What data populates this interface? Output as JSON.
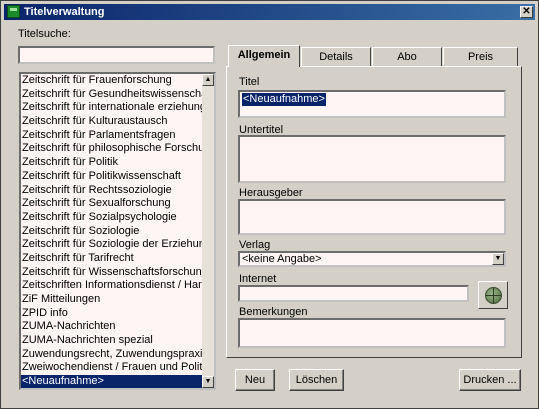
{
  "window": {
    "title": "Titelverwaltung",
    "close_glyph": "✕"
  },
  "search": {
    "label": "Titelsuche:",
    "value": ""
  },
  "list": {
    "items": [
      "Zeitschrift für Frauenforschung",
      "Zeitschrift für Gesundheitswissenschaften",
      "Zeitschrift für internationale erziehungs- und",
      "Zeitschrift für Kulturaustausch",
      "Zeitschrift für Parlamentsfragen",
      "Zeitschrift für philosophische Forschung",
      "Zeitschrift für Politik",
      "Zeitschrift für Politikwissenschaft",
      "Zeitschrift für Rechtssoziologie",
      "Zeitschrift für Sexualforschung",
      "Zeitschrift für Sozialpsychologie",
      "Zeitschrift für Soziologie",
      "Zeitschrift für Soziologie der Erziehung und",
      "Zeitschrift für Tarifrecht",
      "Zeitschrift für Wissenschaftsforschung",
      "Zeitschriften  Informationsdienst / Hans-B",
      "ZiF Mitteilungen",
      "ZPID info",
      "ZUMA-Nachrichten",
      "ZUMA-Nachrichten spezial",
      "Zuwendungsrecht, Zuwendungspraxis",
      "Zweiwochendienst / Frauen und Politik",
      "<Neuaufnahme>"
    ],
    "selected_index": 22,
    "scroll_up_glyph": "▲",
    "scroll_down_glyph": "▼"
  },
  "tabs": [
    {
      "label": "Allgemein",
      "active": true
    },
    {
      "label": "Details",
      "active": false
    },
    {
      "label": "Abo",
      "active": false
    },
    {
      "label": "Preis",
      "active": false
    }
  ],
  "form": {
    "titel_label": "Titel",
    "titel_value": "<Neuaufnahme>",
    "untertitel_label": "Untertitel",
    "untertitel_value": "",
    "herausgeber_label": "Herausgeber",
    "herausgeber_value": "",
    "verlag_label": "Verlag",
    "verlag_value": "<keine Angabe>",
    "verlag_arrow_glyph": "▼",
    "internet_label": "Internet",
    "internet_value": "",
    "bemerkungen_label": "Bemerkungen",
    "bemerkungen_value": ""
  },
  "buttons": {
    "neu": "Neu",
    "loeschen": "Löschen",
    "drucken": "Drucken ..."
  },
  "colors": {
    "title_start": "#0a246a",
    "title_end": "#3a6ea5",
    "field_bg": "#fff5f5",
    "selection": "#0a246a",
    "face": "#d4d0c8"
  },
  "icons": {
    "app": "app-icon",
    "close": "close-icon",
    "web": "globe-icon"
  }
}
